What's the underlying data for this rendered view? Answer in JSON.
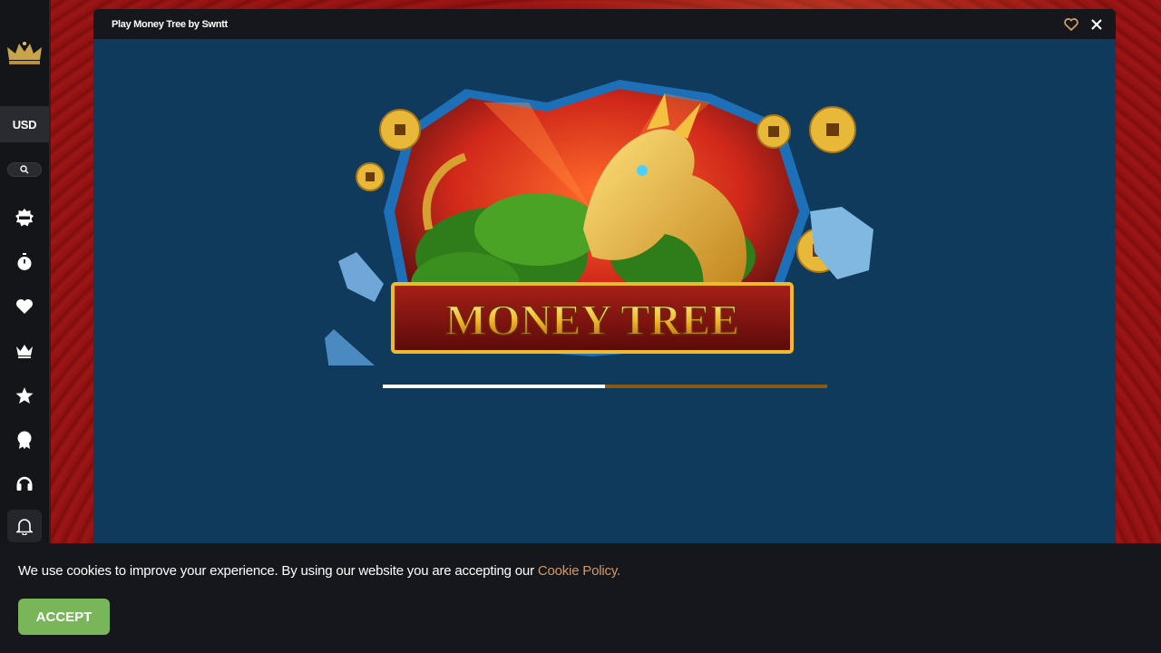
{
  "sidebar": {
    "currency": "USD",
    "icons": [
      {
        "name": "new-games-icon"
      },
      {
        "name": "stopwatch-icon"
      },
      {
        "name": "heart-icon"
      },
      {
        "name": "crown-icon"
      },
      {
        "name": "star-icon"
      },
      {
        "name": "award-icon"
      },
      {
        "name": "headset-icon"
      },
      {
        "name": "bell-icon"
      }
    ]
  },
  "modal": {
    "title": "Play Money Tree by Swntt",
    "game_logo_text": "MONEY TREE",
    "loading_progress": 0.5
  },
  "cookie": {
    "text": "We use cookies to improve your experience. By using our website you are accepting our ",
    "link": "Cookie Policy.",
    "accept": "ACCEPT"
  },
  "colors": {
    "accent_gold": "#d19a66",
    "accept_green": "#79b65a",
    "game_bg": "#0f3a5c",
    "progress_track": "#8a5a12"
  }
}
